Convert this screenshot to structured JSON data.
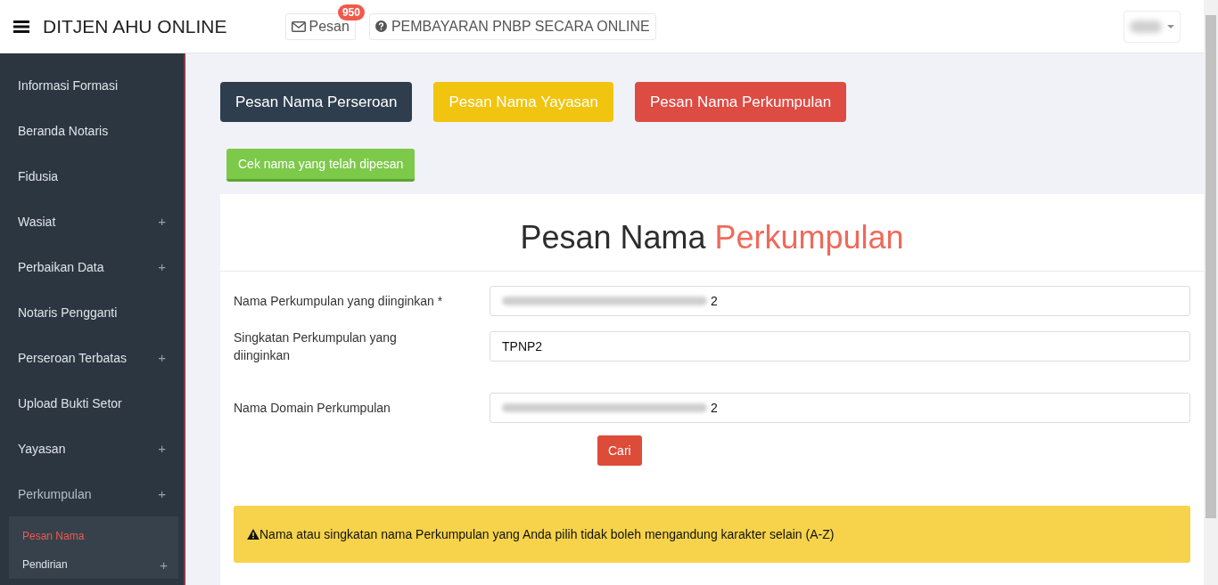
{
  "header": {
    "title": "DITJEN AHU ONLINE",
    "messages_button": {
      "label": "Pesan",
      "badge": "950"
    },
    "payment_link": "PEMBAYARAN PNBP SECARA ONLINE"
  },
  "sidebar": {
    "items": [
      {
        "label": "Informasi Formasi"
      },
      {
        "label": "Beranda Notaris"
      },
      {
        "label": "Fidusia"
      },
      {
        "label": "Wasiat",
        "toggle": "+"
      },
      {
        "label": "Perbaikan Data",
        "toggle": "+"
      },
      {
        "label": "Notaris Pengganti"
      },
      {
        "label": "Perseroan Terbatas",
        "toggle": "+"
      },
      {
        "label": "Upload Bukti Setor"
      },
      {
        "label": "Yayasan",
        "toggle": "+"
      },
      {
        "label": "Perkumpulan",
        "toggle": "+",
        "expanded": true,
        "children": [
          {
            "label": "Pesan Nama",
            "selected": true
          },
          {
            "label": "Pendirian",
            "toggle": "+",
            "selected": false
          }
        ]
      }
    ]
  },
  "action_buttons": [
    {
      "label": "Pesan Nama Perseroan",
      "kind": "dark"
    },
    {
      "label": "Pesan Nama Yayasan",
      "kind": "warning"
    },
    {
      "label": "Pesan Nama Perkumpulan",
      "kind": "danger"
    }
  ],
  "check_button": "Cek nama yang telah dipesan",
  "form": {
    "title": "Pesan Nama",
    "title_highlight": "Perkumpulan",
    "fields": [
      {
        "label": "Nama Perkumpulan yang diinginkan *",
        "value": "2",
        "redacted": true
      },
      {
        "label": "Singkatan Perkumpulan yang diinginkan",
        "value": "TPNP2",
        "redacted": false
      },
      {
        "label": "Nama Domain Perkumpulan",
        "value": "2",
        "redacted": true
      }
    ],
    "search_button": "Cari",
    "alert": "Nama atau singkatan nama Perkumpulan yang Anda pilih tidak boleh mengandung karakter selain (A-Z)"
  }
}
